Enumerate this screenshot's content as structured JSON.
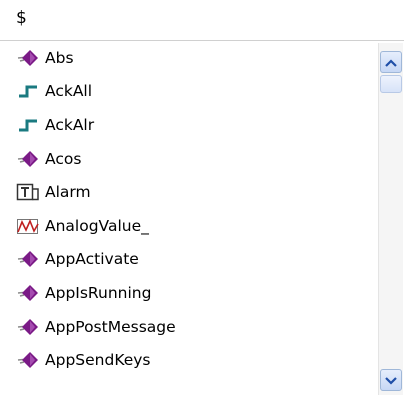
{
  "search": {
    "value": "$"
  },
  "list": {
    "items": [
      {
        "label": "Abs",
        "icon": "function-diamond-icon"
      },
      {
        "label": "AckAll",
        "icon": "pulse-step-icon"
      },
      {
        "label": "AckAlr",
        "icon": "pulse-step-icon"
      },
      {
        "label": "Acos",
        "icon": "function-diamond-icon"
      },
      {
        "label": "Alarm",
        "icon": "text-tag-icon"
      },
      {
        "label": "AnalogValue_",
        "icon": "analog-wave-icon"
      },
      {
        "label": "AppActivate",
        "icon": "function-diamond-icon"
      },
      {
        "label": "AppIsRunning",
        "icon": "function-diamond-icon"
      },
      {
        "label": "AppPostMessage",
        "icon": "function-diamond-icon"
      },
      {
        "label": "AppSendKeys",
        "icon": "function-diamond-icon"
      }
    ]
  },
  "colors": {
    "diamond": "#7a1a86",
    "pulse": "#1a7a80",
    "wave": "#c02020",
    "scroll_arrow": "#1f4fa8"
  }
}
